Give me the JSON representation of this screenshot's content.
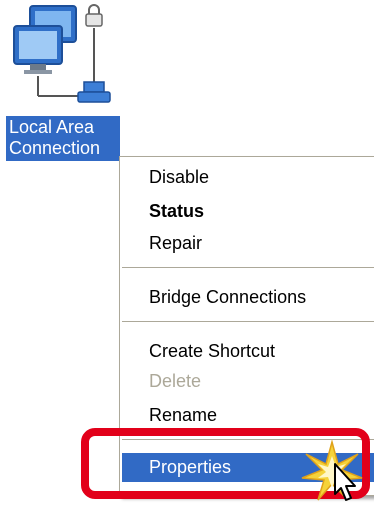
{
  "desktop_icon": {
    "icon": "network-connection-icon",
    "label_line1": "Local Area",
    "label_line2": "Connection"
  },
  "context_menu": {
    "items": [
      {
        "label": "Disable",
        "style": "normal"
      },
      {
        "label": "Status",
        "style": "bold"
      },
      {
        "label": "Repair",
        "style": "normal"
      },
      {
        "label": "Bridge Connections",
        "style": "normal"
      },
      {
        "label": "Create Shortcut",
        "style": "normal"
      },
      {
        "label": "Delete",
        "style": "disabled"
      },
      {
        "label": "Rename",
        "style": "normal"
      },
      {
        "label": "Properties",
        "style": "selected"
      }
    ],
    "selected_color": "#316ac5",
    "disabled_color": "#aca899"
  },
  "annotation": {
    "highlight_color": "#e2001a",
    "cursor": "pointer-cursor-icon",
    "click_effect": "click-burst-icon"
  }
}
